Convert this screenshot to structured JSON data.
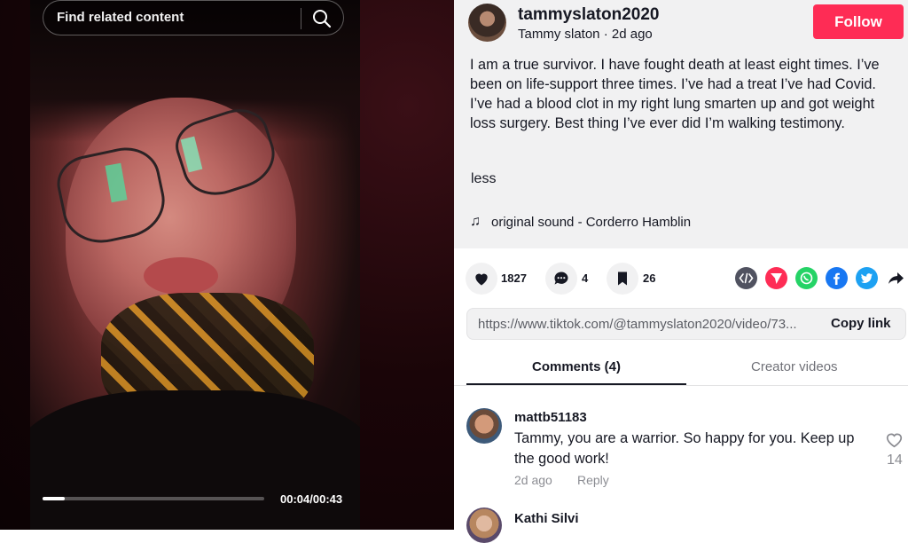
{
  "search": {
    "placeholder": "Find related content"
  },
  "player": {
    "time": "00:04/00:43",
    "progress": 0.1
  },
  "post": {
    "username": "tammyslaton2020",
    "display_name": "Tammy slaton",
    "age": "2d ago",
    "follow_label": "Follow",
    "description": "I am a true survivor. I have fought death at least eight times. I’ve been on life-support three times. I’ve had a treat I’ve had Covid. I’ve had a blood clot in my right lung smarten up and got weight loss surgery. Best thing I’ve ever did I’m walking testimony.",
    "less_label": "less",
    "sound": "original sound - Corderro Hamblin"
  },
  "actions": {
    "likes": "1827",
    "comments": "4",
    "saves": "26"
  },
  "share": {
    "link": "https://www.tiktok.com/@tammyslaton2020/video/73...",
    "copy_label": "Copy link"
  },
  "tabs": {
    "comments": "Comments (4)",
    "creator": "Creator videos"
  },
  "comments": [
    {
      "user": "mattb51183",
      "text": "Tammy, you are a warrior. So happy for you. Keep up the good work!",
      "date": "2d ago",
      "reply_label": "Reply",
      "likes": "14"
    },
    {
      "user": "Kathi Silvi"
    }
  ],
  "colors": {
    "follow": "#fe2c55",
    "text": "#161823"
  }
}
